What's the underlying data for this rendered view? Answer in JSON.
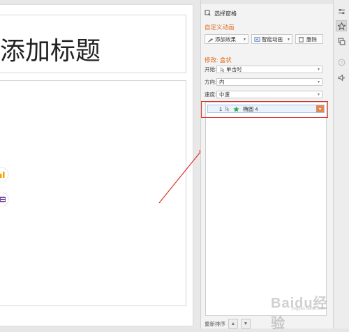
{
  "slide": {
    "title": "添加标题"
  },
  "pane": {
    "selection_pane_label": "选择窗格",
    "custom_animation_title": "自定义动画",
    "add_effect_label": "添加效果",
    "smart_animation_label": "智能动画",
    "delete_label": "删除",
    "modify_title": "修改: 盒状",
    "start_label": "开始:",
    "start_value": "单击时",
    "direction_label": "方向:",
    "direction_value": "内",
    "speed_label": "速度:",
    "speed_value": "中速",
    "animation_items": [
      {
        "index": "1",
        "name": "椭圆 4"
      }
    ],
    "reorder_label": "重新排序"
  },
  "watermark": {
    "text": "Baidu经验",
    "sub": "jingyan.baidu.com"
  },
  "colors": {
    "section_orange": "#e06a1c",
    "highlight_red": "#e0302a",
    "item_dropdown_orange": "#e08850",
    "star_green": "#2aa84a"
  },
  "icons": [
    "selection-pane-icon",
    "add-effect-icon",
    "smart-animation-icon",
    "delete-icon",
    "mouse-click-icon",
    "star-icon",
    "chevron-down-icon",
    "move-up-icon",
    "move-down-icon",
    "property-icon",
    "animation-icon",
    "slide-switch-icon",
    "help-icon",
    "sound-icon",
    "chart-icon",
    "video-icon"
  ]
}
